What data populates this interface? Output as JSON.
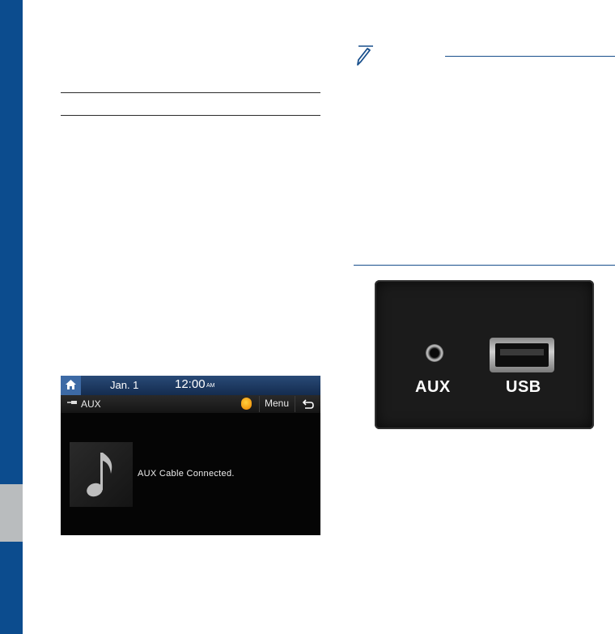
{
  "status_bar": {
    "date": "Jan.  1",
    "time": "12:00",
    "ampm": "AM"
  },
  "toolbar": {
    "source": "AUX",
    "menu": "Menu"
  },
  "screen": {
    "message": "AUX Cable Connected."
  },
  "photo": {
    "aux_label": "AUX",
    "usb_label": "USB"
  },
  "colors": {
    "side_bar": "#0c4c8e",
    "tab": "#b9bcbe",
    "rule_blue": "#184f8c"
  },
  "icons": [
    "note-pencil-icon",
    "home-icon",
    "aux-source-icon",
    "app-icon",
    "back-icon",
    "music-note-icon"
  ]
}
